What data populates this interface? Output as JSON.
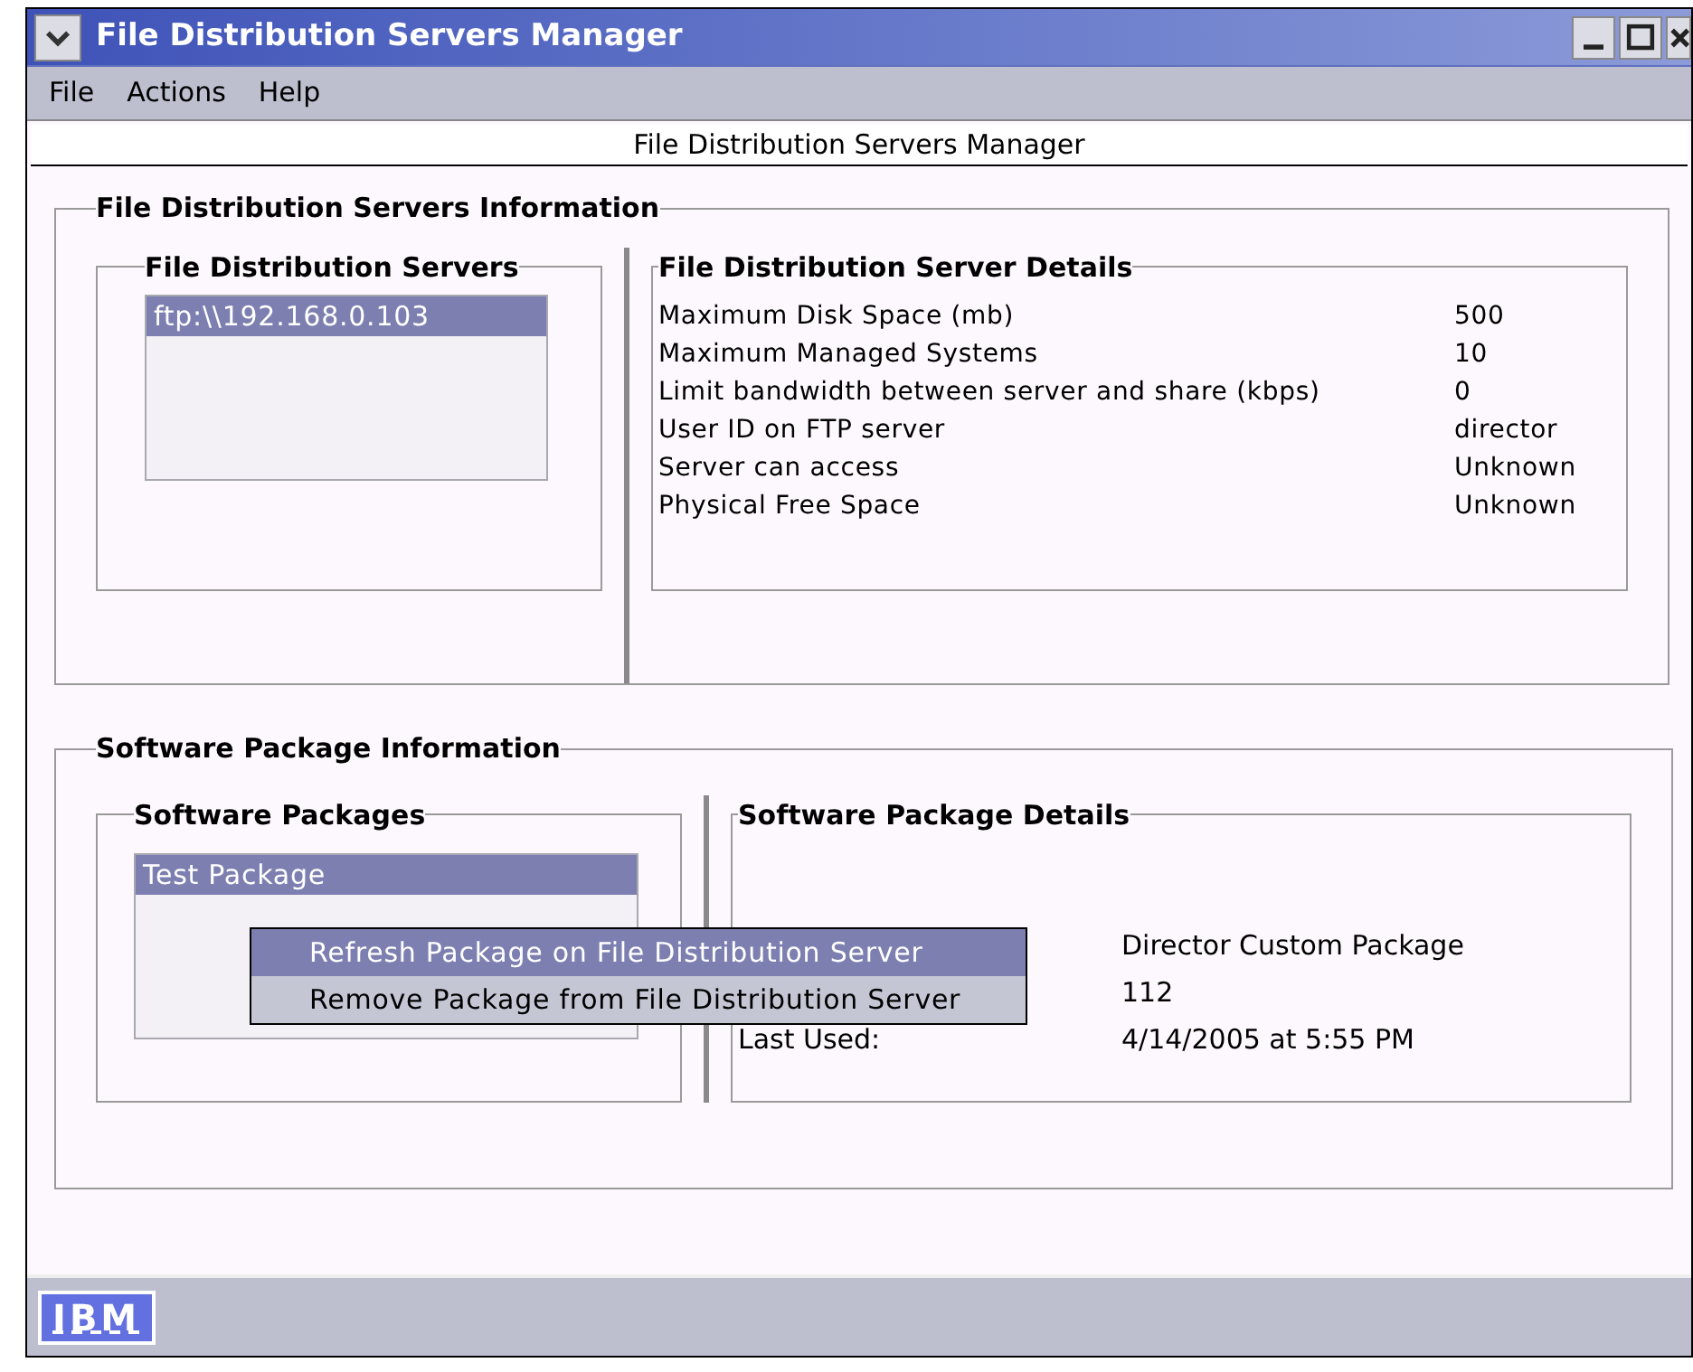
{
  "window": {
    "title": "File Distribution Servers Manager"
  },
  "menu_bar": [
    "File",
    "Actions",
    "Help"
  ],
  "header": "File Distribution Servers Manager",
  "servers_section": {
    "title": "File Distribution Servers Information",
    "servers": {
      "title": "File Distribution Servers",
      "items": [
        {
          "label": "ftp:\\\\192.168.0.103",
          "selected": true
        }
      ]
    },
    "details": {
      "title": "File Distribution Server Details",
      "rows": [
        {
          "label": "Maximum Disk Space (mb)",
          "value": "500"
        },
        {
          "label": "Maximum Managed Systems",
          "value": "10"
        },
        {
          "label": "Limit bandwidth between server and share (kbps)",
          "value": "0"
        },
        {
          "label": "User ID on FTP server",
          "value": "director"
        },
        {
          "label": "Server can access",
          "value": "Unknown"
        },
        {
          "label": "Physical Free Space",
          "value": "Unknown"
        }
      ]
    }
  },
  "packages_section": {
    "title": "Software Package Information",
    "packages": {
      "title": "Software Packages",
      "items": [
        {
          "label": "Test Package",
          "selected": true
        }
      ]
    },
    "details": {
      "title": "Software Package Details",
      "rows": [
        {
          "value": "Director Custom Package"
        },
        {
          "value": "112"
        },
        {
          "label": "Last Used:",
          "value": "4/14/2005 at 5:55 PM"
        }
      ]
    }
  },
  "context_menu": [
    {
      "label": "Refresh Package on File Distribution Server",
      "selected": true
    },
    {
      "label": "Remove Package from File Distribution Server",
      "selected": false
    }
  ],
  "status_bar": {
    "logo": "IBM"
  }
}
